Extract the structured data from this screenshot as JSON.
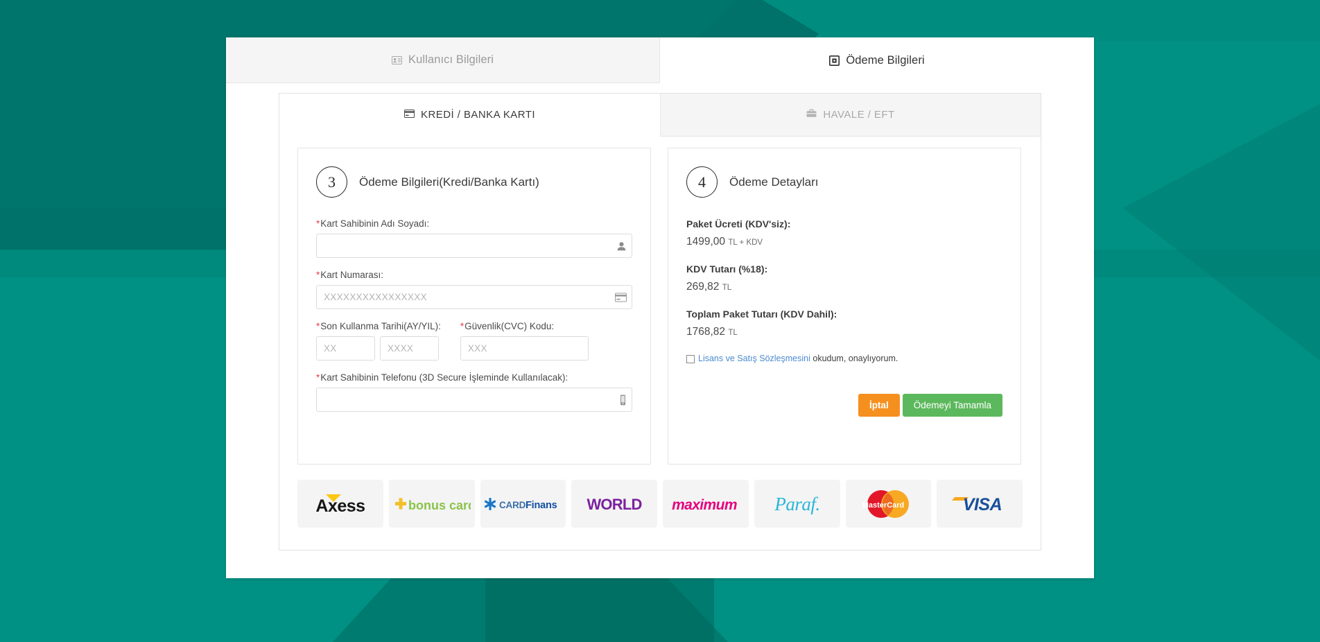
{
  "colors": {
    "bg_teal_dark": "#00726a",
    "bg_teal_light": "#009184",
    "accent_green": "#5cb85c",
    "accent_orange": "#f5901f",
    "required_red": "#e8394a",
    "link_blue": "#4a8bd0"
  },
  "step_tabs": [
    {
      "label": "Kullanıcı Bilgileri",
      "icon": "id-card-icon",
      "active": false
    },
    {
      "label": "Ödeme Bilgileri",
      "icon": "payment-card-icon",
      "active": true
    }
  ],
  "method_tabs": [
    {
      "label": "KREDİ / BANKA KARTI",
      "icon": "credit-card-icon",
      "active": true
    },
    {
      "label": "HAVALE / EFT",
      "icon": "briefcase-icon",
      "active": false
    }
  ],
  "payment_form": {
    "step_number": "3",
    "step_title": "Ödeme Bilgileri(Kredi/Banka Kartı)",
    "fields": {
      "cardholder_name": {
        "label": "Kart Sahibinin Adı Soyadı:",
        "required_mark": "*",
        "value": "",
        "placeholder": "",
        "icon": "user-icon"
      },
      "card_number": {
        "label": "Kart Numarası:",
        "required_mark": "*",
        "value": "",
        "placeholder": "XXXXXXXXXXXXXXXX",
        "icon": "credit-card-icon"
      },
      "expiry": {
        "label": "Son Kullanma Tarihi(AY/YIL):",
        "required_mark": "*",
        "month_value": "",
        "month_placeholder": "XX",
        "year_value": "",
        "year_placeholder": "XXXX"
      },
      "cvc": {
        "label": "Güvenlik(CVC) Kodu:",
        "required_mark": "*",
        "value": "",
        "placeholder": "XXX"
      },
      "phone": {
        "label": "Kart Sahibinin Telefonu (3D Secure İşleminde Kullanılacak):",
        "required_mark": "*",
        "value": "",
        "placeholder": "",
        "icon": "mobile-phone-icon"
      }
    }
  },
  "payment_details": {
    "step_number": "4",
    "step_title": "Ödeme Detayları",
    "lines": [
      {
        "label": "Paket Ücreti (KDV'siz):",
        "amount": "1499,00",
        "unit": "TL + KDV"
      },
      {
        "label": "KDV Tutarı (%18):",
        "amount": "269,82",
        "unit": "TL"
      },
      {
        "label": "Toplam Paket Tutarı (KDV Dahil):",
        "amount": "1768,82",
        "unit": "TL"
      }
    ],
    "agreement": {
      "checked": false,
      "link_text": "Lisans ve Satış Sözleşmesini",
      "rest_text": " okudum, onaylıyorum."
    },
    "cancel_button": "İptal",
    "confirm_button": "Ödemeyi Tamamla"
  },
  "card_logos": [
    {
      "name": "axess-logo",
      "label": "Axess"
    },
    {
      "name": "bonus-card-logo",
      "label": "bonus card"
    },
    {
      "name": "cardfinans-logo",
      "label": "CARDFinans"
    },
    {
      "name": "world-logo",
      "label": "WORLD"
    },
    {
      "name": "maximum-logo",
      "label": "maximum"
    },
    {
      "name": "paraf-logo",
      "label": "Paraf"
    },
    {
      "name": "mastercard-logo",
      "label": "MasterCard"
    },
    {
      "name": "visa-logo",
      "label": "VISA"
    }
  ]
}
